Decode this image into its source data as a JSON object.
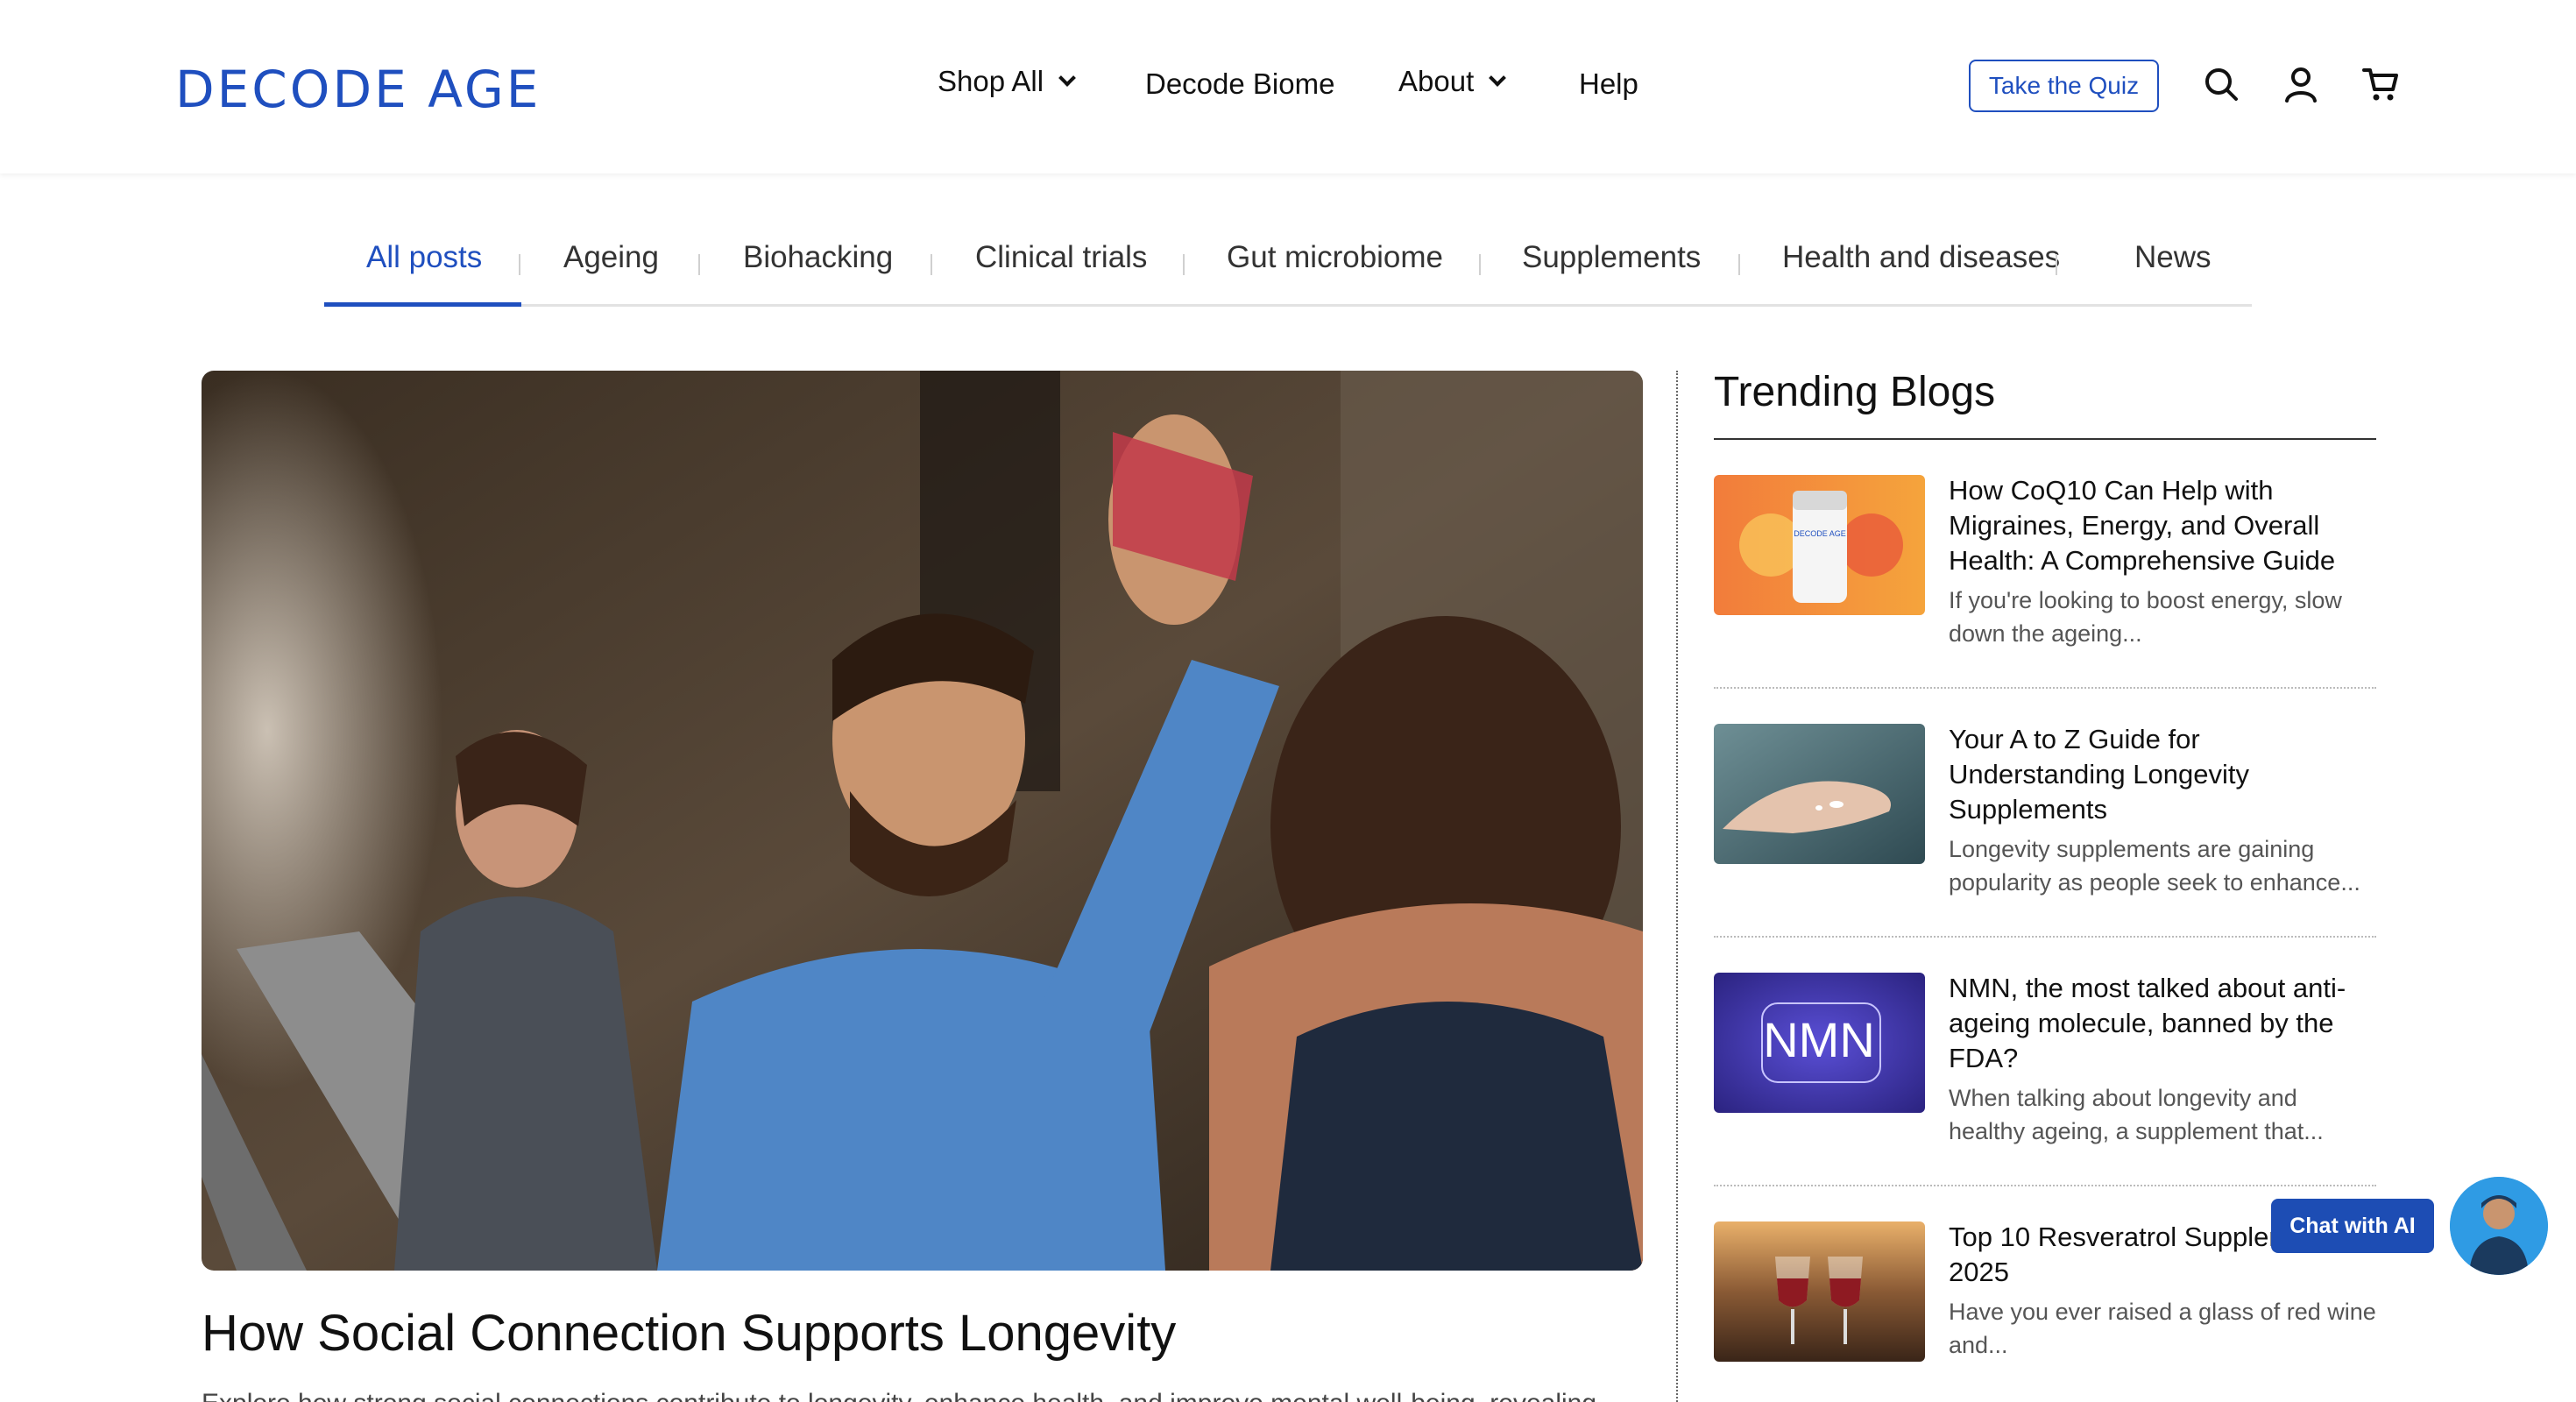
{
  "brand": {
    "logo_text": "DECODE AGE",
    "accent": "#1f4fbf"
  },
  "nav": {
    "shop_all": "Shop All",
    "decode_biome": "Decode Biome",
    "about": "About",
    "help": "Help",
    "quiz_button": "Take the Quiz",
    "icons": [
      "search-icon",
      "account-icon",
      "cart-icon"
    ]
  },
  "tabs": [
    {
      "label": "All posts",
      "active": true
    },
    {
      "label": "Ageing"
    },
    {
      "label": "Biohacking"
    },
    {
      "label": "Clinical trials"
    },
    {
      "label": "Gut microbiome"
    },
    {
      "label": "Supplements"
    },
    {
      "label": "Health and diseases"
    },
    {
      "label": "News"
    }
  ],
  "hero": {
    "title": "How Social Connection Supports Longevity",
    "excerpt": "Explore how strong social connections contribute to longevity, enhance health, and improve mental well-being, revealing"
  },
  "trending": {
    "heading": "Trending Blogs",
    "items": [
      {
        "title": "How CoQ10 Can Help with Migraines, Energy, and Overall Health: A Comprehensive Guide",
        "excerpt": "If you're looking to boost energy, slow down the ageing...",
        "thumb_text": "DECODE AGE"
      },
      {
        "title": "Your A to Z Guide for Understanding Longevity Supplements",
        "excerpt": "Longevity supplements are gaining popularity as people seek to enhance..."
      },
      {
        "title": "NMN, the most talked about anti-ageing molecule, banned by the FDA?",
        "excerpt": "When talking about longevity and healthy ageing, a supplement that...",
        "thumb_text": "NMN"
      },
      {
        "title": "Top 10 Resveratrol Supplements 2025",
        "excerpt": "Have you ever raised a glass of red wine and..."
      }
    ]
  },
  "chat": {
    "label": "Chat with AI"
  }
}
